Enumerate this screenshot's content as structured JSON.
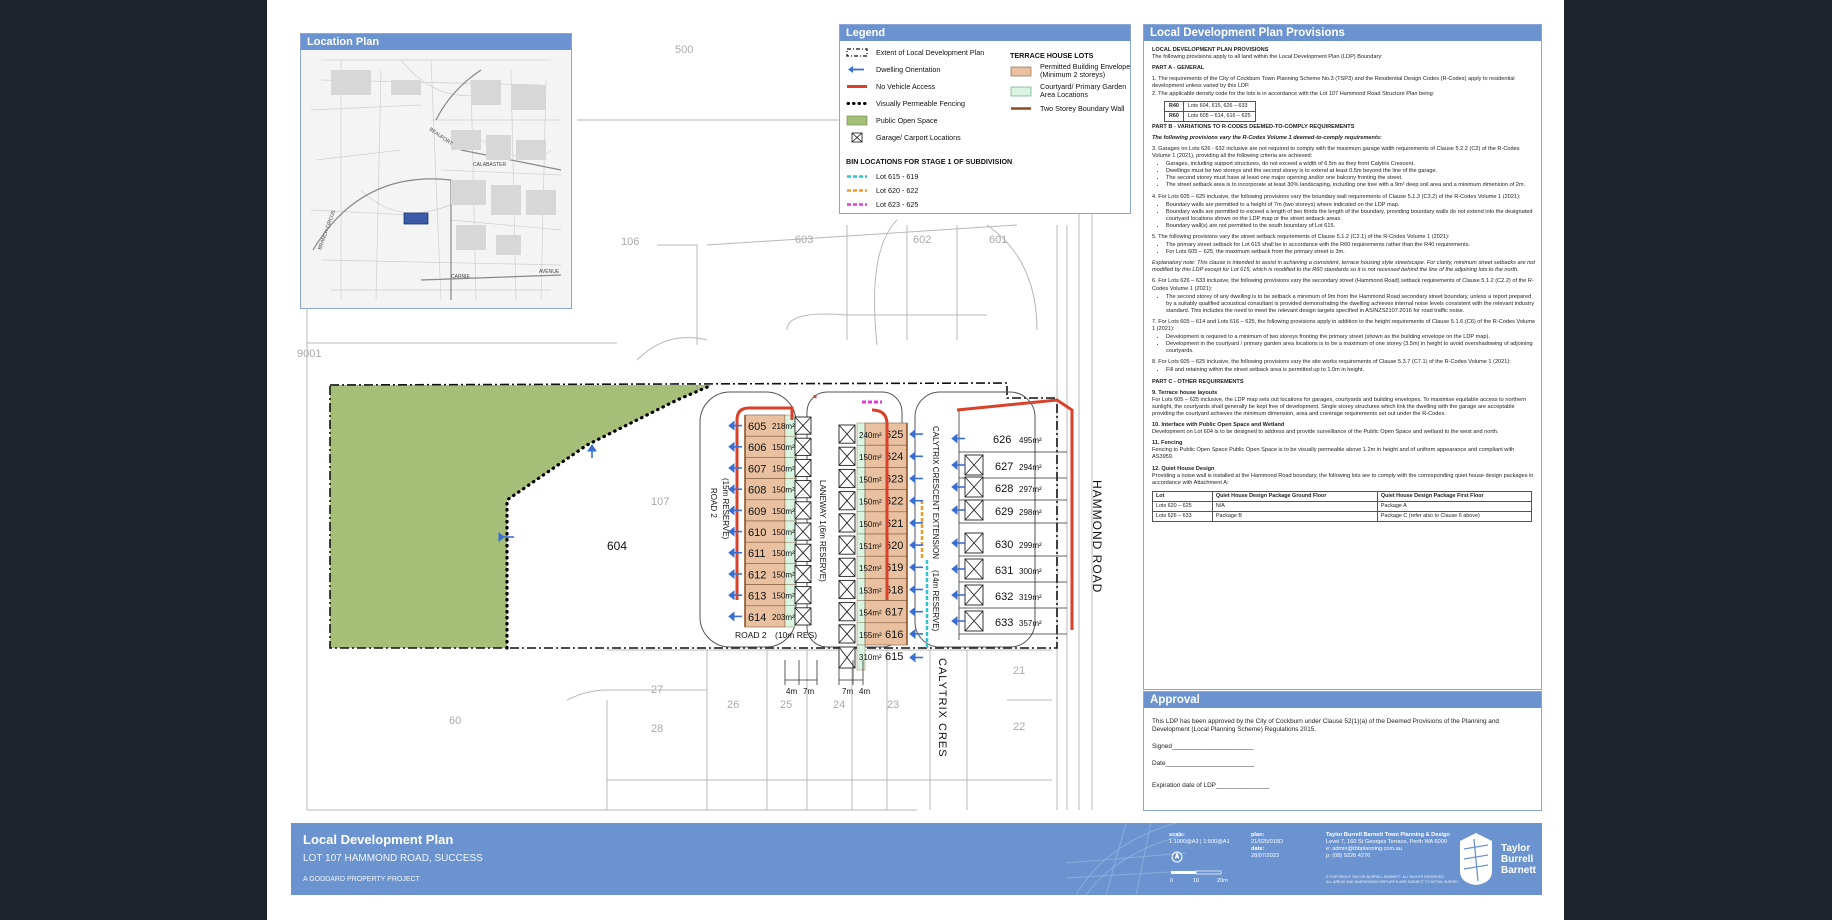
{
  "location_plan": {
    "title": "Location Plan",
    "streets": [
      "BEAUFORT",
      "BRANCH CIRCUS",
      "CALABASTER",
      "CARNIE",
      "AVENUE"
    ]
  },
  "legend": {
    "title": "Legend",
    "items": [
      {
        "label": "Extent of Local Development Plan",
        "symbol": "dash-box"
      },
      {
        "label": "Dwelling Orientation",
        "symbol": "arrow"
      },
      {
        "label": "No Vehicle Access",
        "symbol": "red-line"
      },
      {
        "label": "Visually Permeable Fencing",
        "symbol": "dots"
      },
      {
        "label": "Public Open Space",
        "symbol": "green-fill"
      },
      {
        "label": "Garage/ Carport Locations",
        "symbol": "cross-box"
      }
    ],
    "terrace_title": "TERRACE HOUSE LOTS",
    "terrace_items": [
      {
        "label": "Permitted Building Envelope",
        "label2": "(Minimum 2 storeys)",
        "symbol": "tan-fill"
      },
      {
        "label": "Courtyard/ Primary Garden",
        "label2": "Area Locations",
        "symbol": "mint-fill"
      },
      {
        "label": "Two Storey Boundary Wall",
        "symbol": "brown-line"
      }
    ],
    "bin_title": "BIN LOCATIONS FOR STAGE 1 OF SUBDIVISION",
    "bin_items": [
      {
        "label": "Lot 615 - 619",
        "color": "#2ec4cf"
      },
      {
        "label": "Lot 620 - 622",
        "color": "#f09a2a"
      },
      {
        "label": "Lot 623 - 625",
        "color": "#e23bd8"
      }
    ]
  },
  "colors": {
    "accent": "#6a93cf",
    "pos": "#a6bf78",
    "envelope": "#e9c1a0",
    "courtyard": "#d9f5e2",
    "no_access": "#d9412a",
    "boundary_wall": "#8a4b1f",
    "arrow": "#3a6fd1"
  },
  "site_plan": {
    "west_lots": [
      {
        "lot": "605",
        "area": "218m²"
      },
      {
        "lot": "606",
        "area": "150m²"
      },
      {
        "lot": "607",
        "area": "150m²"
      },
      {
        "lot": "608",
        "area": "150m²"
      },
      {
        "lot": "609",
        "area": "150m²"
      },
      {
        "lot": "610",
        "area": "150m²"
      },
      {
        "lot": "611",
        "area": "150m²"
      },
      {
        "lot": "612",
        "area": "150m²"
      },
      {
        "lot": "613",
        "area": "150m²"
      },
      {
        "lot": "614",
        "area": "203m²"
      }
    ],
    "middle_lots": [
      {
        "lot": "625",
        "area": "240m²"
      },
      {
        "lot": "624",
        "area": "150m²"
      },
      {
        "lot": "623",
        "area": "150m²"
      },
      {
        "lot": "622",
        "area": "150m²"
      },
      {
        "lot": "621",
        "area": "150m²"
      },
      {
        "lot": "620",
        "area": "151m²"
      },
      {
        "lot": "619",
        "area": "152m²"
      },
      {
        "lot": "618",
        "area": "153m²"
      },
      {
        "lot": "617",
        "area": "154m²"
      },
      {
        "lot": "616",
        "area": "155m²"
      },
      {
        "lot": "615",
        "area": "310m²"
      }
    ],
    "east_lots": [
      {
        "lot": "626",
        "area": "495m²"
      },
      {
        "lot": "627",
        "area": "294m²"
      },
      {
        "lot": "628",
        "area": "297m²"
      },
      {
        "lot": "629",
        "area": "298m²"
      },
      {
        "lot": "630",
        "area": "299m²"
      },
      {
        "lot": "631",
        "area": "300m²"
      },
      {
        "lot": "632",
        "area": "319m²"
      },
      {
        "lot": "633",
        "area": "357m²"
      }
    ],
    "lot_604": "604",
    "lot_107": "107",
    "context_numbers": {
      "n500": "500",
      "n106": "106",
      "n603": "603",
      "n602": "602",
      "n601": "601",
      "n9001": "9001",
      "n27": "27",
      "n28": "28",
      "n26": "26",
      "n25": "25",
      "n24": "24",
      "n23": "23",
      "n21": "21",
      "n22": "22",
      "n60": "60"
    },
    "road_labels": {
      "road2_vertical": "ROAD 2",
      "road2_vertical_res": "(15m RESERVE)",
      "laneway": "LANEWAY 1",
      "laneway_res": "(6m RESERVE)",
      "calytrix_ext": "CALYTRIX CRESCENT EXTENSION",
      "calytrix_ext_res": "(14m RESERVE)",
      "road2_bottom": "ROAD 2",
      "road2_bottom_res": "(10m RES)",
      "hammond": "HAMMOND ROAD",
      "calytrix_cres": "CALYTRIX CRES"
    },
    "dimensions": [
      "4m",
      "7m",
      "7m",
      "4m"
    ]
  },
  "provisions": {
    "title": "Local Development Plan Provisions",
    "intro_head": "LOCAL DEVELOPMENT PLAN PROVISIONS",
    "intro": "The following provisions apply to all land within the Local Development Plan (LDP) Boundary:",
    "part_a": "PART A - GENERAL",
    "a1": "1.  The requirements of the City of Cockburn Town Planning Scheme No.3 (TSP3) and the Residential Design Codes (R-Codes) apply to residential development unless varied by this LDP.",
    "a2": "2.  The applicable density code for the lots is in accordance with the Lot 107 Hammond Road Structure Plan being:",
    "density": [
      {
        "code": "R40",
        "lots": "Lots 604, 615, 626 – 633"
      },
      {
        "code": "R60",
        "lots": "Lots 605 – 614, 616 – 625"
      }
    ],
    "part_b": "PART B - VARIATIONS TO R-CODES DEEMED-TO-COMPLY REQUIREMENTS",
    "b_intro": "The following provisions vary the R-Codes Volume 1 deemed-to-comply requirements:",
    "p3": "3. Garages on Lots 626 - 632 inclusive are not required to comply with the maximum garage width requirements of Clause 5.2.2 (C2) of the R-Codes Volume 1 (2021), providing all the following criteria are achieved:",
    "p3_items": [
      "Garages, including support structures, do not exceed a width of 6.5m as they front Calytrix Crescent.",
      "Dwellings must be two storeys and the second storey is to extend at least 0.5m beyond the line of the garage.",
      "The second storey must have at least one major opening and/or one balcony fronting the street.",
      "The street setback area is to incorporate at least 30% landscaping, including one tree with a 9m² deep soil area and a minimum dimension of 2m."
    ],
    "p4": "4. For Lots 605 – 625 inclusive, the following provisions vary the boundary wall requirements of Clause 5.1.3 (C3.2) of the R-Codes Volume 1 (2021):",
    "p4_items": [
      "Boundary walls are permitted to a height of 7m (two storeys) where indicated on the LDP map.",
      "Boundary walls are permitted to exceed a length of two thirds the length of the boundary, providing boundary walls do not extend into the designated courtyard locations shown on the LDP map or the street setback areas.",
      "Boundary wall(s) are not permitted to the south boundary of Lot 615."
    ],
    "p5": "5. The following provisions vary the street setback requirements of Clause 5.1.2 (C2.1) of the R-Codes Volume 1 (2021):",
    "p5_items": [
      "The primary street setback for Lot 615 shall be in accordance with the R60 requirements rather than the R40 requirements.",
      "For Lots 605 – 625, the maximum setback from the primary street is 3m."
    ],
    "p5_note": "Explanatory note: This clause is intended to assist in achieving a consistent, terrace housing style streetscape. For clarity, minimum street setbacks are not modified by this LDP except for Lot 615, which is modified to the R60 standards so it is not recessed behind the line of the adjoining lots to the north.",
    "p6": "6. For Lots 626 – 633 inclusive, the following provisions vary the secondary street (Hammond Road) setback requirements of Clause 5.1.2 (C2.2) of the R-Codes Volume 1 (2021):",
    "p6_items": [
      "The second storey of any dwelling is to be setback a minimum of 9m from the Hammond Road secondary street boundary, unless a report prepared by a suitably qualified acoustical consultant is provided demonstrating the dwelling achieves internal noise levels consistent with the relevant industry standard. This includes the need to meet the relevant design targets specified in AS/NZS2107:2016 for road traffic noise."
    ],
    "p7": "7. For Lots 605 – 614 and Lots 616 – 625, the following provisions apply in addition to the height requirements of Clause 5.1.6 (C6) of the R-Codes Volume 1 (2021):",
    "p7_items": [
      "Development is required to a minimum of two storeys fronting the primary street (shown as the building envelope on the LDP map).",
      "Development in the courtyard / primary garden area locations is to be a maximum of one storey (3.5m) in height to avoid overshadowing of adjoining courtyards."
    ],
    "p8": "8. For Lots 605 – 625 inclusive, the following provisions vary the site works requirements of Clause 5.3.7 (C7.1) of the R-Codes Volume 1 (2021):",
    "p8_items": [
      "Fill and retaining within the street setback area is permitted up to 1.0m in height."
    ],
    "part_c": "PART C - OTHER REQUIREMENTS",
    "c9_head": "9. Terrace house layouts",
    "c9": "For Lots 605 – 625 inclusive, the LDP map sets out locations for garages, courtyards and building envelopes. To maximise equitable access to northern sunlight, the courtyards shall generally be kept free of development. Single storey structures which link the dwelling with the garage are acceptable providing the courtyard achieves the minimum dimension, area and coverage requirements set out under the R-Codes.",
    "c10_head": "10. Interface with Public Open Space and Wetland",
    "c10": "Development on Lot 604 is to be designed to address and provide surveillance of the Public Open Space and wetland to the west and north.",
    "c11_head": "11. Fencing",
    "c11": "Fencing to Public Open Space Public Open Space is to be visually permeable above 1.2m in height and of uniform appearance and compliant with AS3959.",
    "c12_head": "12. Quiet House Design",
    "c12": "Providing a noise wall is installed at the Hammond Road boundary, the following lots are to comply with the corresponding quiet house design packages in accordance with Attachment A:",
    "qh_head": [
      "Lot",
      "Quiet House Design Package Ground Floor",
      "Quiet House Design Package First Floor"
    ],
    "qh_rows": [
      [
        "Lots 620 – 625",
        "N/A",
        "Package A"
      ],
      [
        "Lots 626 – 633",
        "Package B",
        "Package C (refer also to Clause 6 above)"
      ]
    ]
  },
  "approval": {
    "title": "Approval",
    "text": "This LDP has been approved by the City of Cockburn under Clause 52(1)(a) of the Deemed Provisions of the Planning and Development (Local Planning Scheme) Regulations 2015.",
    "signed": "Signed_______________________",
    "date": "Date_________________________",
    "expiry": "Expiration date of LDP_______________"
  },
  "titleblock": {
    "title": "Local Development Plan",
    "subtitle": "LOT 107 HAMMOND ROAD, SUCCESS",
    "project": "A GODDARD PROPERTY PROJECT",
    "scale_label": "scale:",
    "scale": "1:1000@A3 | 1:500@A1",
    "plan_label": "plan:",
    "plan": "21/025/015D",
    "date_label": "date:",
    "date": "28/07/2023",
    "scale_ticks": [
      "0",
      "10",
      "20m"
    ],
    "firm": "Taylor Burrell Barnett Town Planning & Design",
    "address": "Level 7, 160 St Georges Terrace, Perth WA 6000",
    "email": "e: admin@tbbplanning.com.au",
    "phone": "p: (08) 9226 4276",
    "copyright": "© COPYRIGHT TAYLOR BURRELL BARNETT. ALL RIGHTS RESERVED.",
    "copyright2": "ALL AREAS AND DIMENSIONS DISPLAYED ARE SUBJECT TO DETAIL SURVEY.",
    "brand": [
      "Taylor",
      "Burrell",
      "Barnett"
    ]
  }
}
